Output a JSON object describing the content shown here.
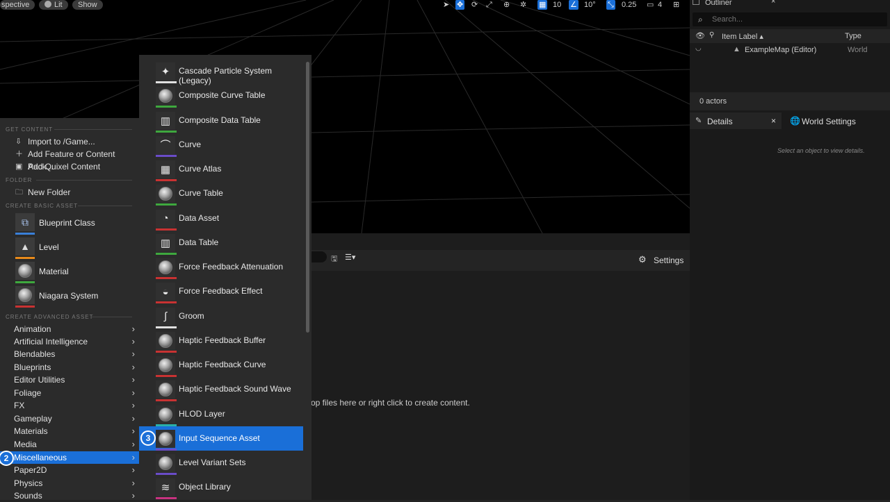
{
  "viewport": {
    "mode_label": "spective",
    "lit_label": "Lit",
    "show_label": "Show",
    "grid_snap": "10",
    "rotation_snap": "10°",
    "scale_snap": "0.25",
    "camera_speed": "4"
  },
  "outliner": {
    "title": "Outliner",
    "search_placeholder": "Search...",
    "col_label": "Item Label ▴",
    "col_type": "Type",
    "row_name": "ExampleMap (Editor)",
    "row_type": "World",
    "actor_count": "0 actors"
  },
  "details": {
    "tab_details": "Details",
    "tab_world": "World Settings",
    "empty_hint": "Select an object to view details."
  },
  "content_browser": {
    "settings_label": "Settings",
    "drop_hint": "op files here or right click to create content."
  },
  "leftmenu": {
    "sec_get": "GET CONTENT",
    "import": "Import to /Game...",
    "add_feature": "Add Feature or Content Pack...",
    "add_quixel": "Add Quixel Content",
    "sec_folder": "FOLDER",
    "new_folder": "New Folder",
    "sec_basic": "CREATE BASIC ASSET",
    "basic": [
      {
        "label": "Blueprint Class",
        "color": "#3a7fd8"
      },
      {
        "label": "Level",
        "color": "#e88a1a"
      },
      {
        "label": "Material",
        "color": "#3ea83e"
      },
      {
        "label": "Niagara System",
        "color": "#c83232"
      }
    ],
    "sec_advanced": "CREATE ADVANCED ASSET",
    "advanced": [
      {
        "label": "Animation"
      },
      {
        "label": "Artificial Intelligence"
      },
      {
        "label": "Blendables"
      },
      {
        "label": "Blueprints"
      },
      {
        "label": "Editor Utilities"
      },
      {
        "label": "Foliage"
      },
      {
        "label": "FX"
      },
      {
        "label": "Gameplay"
      },
      {
        "label": "Materials"
      },
      {
        "label": "Media"
      },
      {
        "label": "Miscellaneous"
      },
      {
        "label": "Paper2D"
      },
      {
        "label": "Physics"
      },
      {
        "label": "Sounds"
      }
    ],
    "badge": "2"
  },
  "submenu": {
    "items": [
      {
        "label": "Cascade Particle System (Legacy)",
        "color": "#e0e0e0",
        "icon": "particle-icon"
      },
      {
        "label": "Composite Curve Table",
        "color": "#3ea83e",
        "icon": "sphere-icon"
      },
      {
        "label": "Composite Data Table",
        "color": "#3ea83e",
        "icon": "table-icon"
      },
      {
        "label": "Curve",
        "color": "#6a4cc8",
        "icon": "curve-icon"
      },
      {
        "label": "Curve Atlas",
        "color": "#c83232",
        "icon": "checker-icon"
      },
      {
        "label": "Curve Table",
        "color": "#3ea83e",
        "icon": "sphere-icon"
      },
      {
        "label": "Data Asset",
        "color": "#c83232",
        "icon": "pie-icon"
      },
      {
        "label": "Data Table",
        "color": "#3ea83e",
        "icon": "table-icon"
      },
      {
        "label": "Force Feedback Attenuation",
        "color": "#c83232",
        "icon": "sphere-icon"
      },
      {
        "label": "Force Feedback Effect",
        "color": "#c83232",
        "icon": "gamepad-icon"
      },
      {
        "label": "Groom",
        "color": "#e0e0e0",
        "icon": "groom-icon"
      },
      {
        "label": "Haptic Feedback Buffer",
        "color": "#c83232",
        "icon": "sphere-icon"
      },
      {
        "label": "Haptic Feedback Curve",
        "color": "#c83232",
        "icon": "sphere-icon"
      },
      {
        "label": "Haptic Feedback Sound Wave",
        "color": "#c83232",
        "icon": "sphere-icon"
      },
      {
        "label": "HLOD Layer",
        "color": "#2ab0a8",
        "icon": "sphere-icon"
      },
      {
        "label": "Input Sequence Asset",
        "color": "#6a4cc8",
        "icon": "sphere-icon"
      },
      {
        "label": "Level Variant Sets",
        "color": "#6a4cc8",
        "icon": "sphere-icon"
      },
      {
        "label": "Object Library",
        "color": "#c83280",
        "icon": "stack-icon"
      }
    ],
    "badge": "3"
  }
}
